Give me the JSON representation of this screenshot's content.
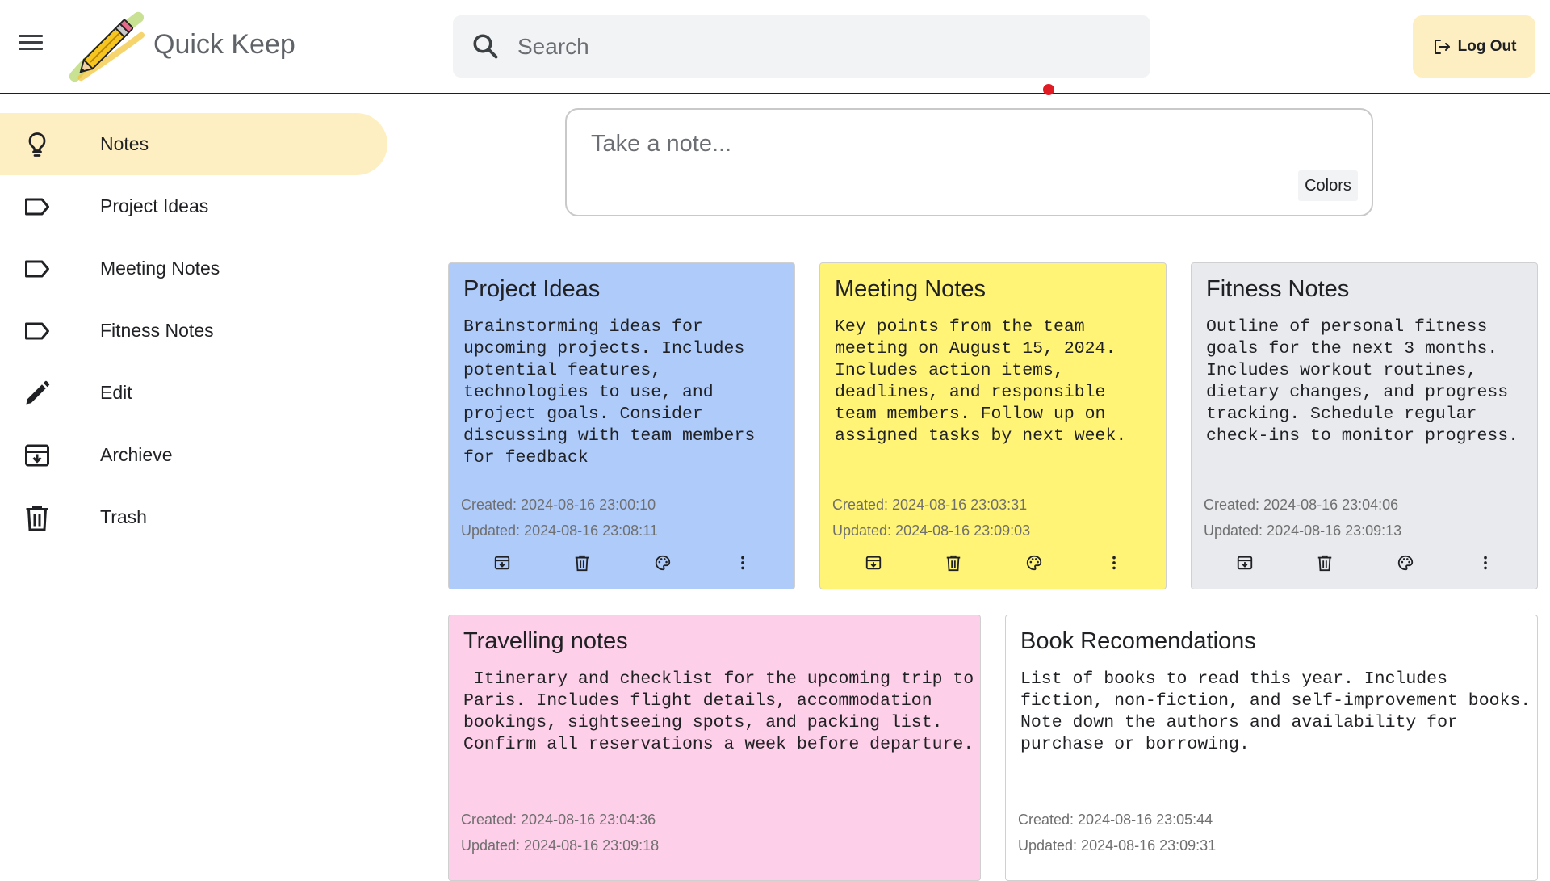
{
  "app": {
    "title": "Quick Keep"
  },
  "header": {
    "search_placeholder": "Search",
    "logout_label": "Log Out"
  },
  "sidebar": {
    "items": [
      {
        "label": "Notes",
        "icon": "lightbulb-icon",
        "active": true
      },
      {
        "label": "Project Ideas",
        "icon": "label-icon"
      },
      {
        "label": "Meeting Notes",
        "icon": "label-icon"
      },
      {
        "label": "Fitness Notes",
        "icon": "label-icon"
      },
      {
        "label": "Edit",
        "icon": "pencil-icon"
      },
      {
        "label": "Archieve",
        "icon": "archive-icon"
      },
      {
        "label": "Trash",
        "icon": "trash-icon"
      }
    ]
  },
  "composer": {
    "placeholder": "Take a note...",
    "colors_label": "Colors"
  },
  "notes": [
    {
      "title": "Project Ideas",
      "body": "Brainstorming ideas for\nupcoming projects. Includes\npotential features,\ntechnologies to use, and\nproject goals. Consider\ndiscussing with team members\nfor feedback",
      "created": "Created: 2024-08-16 23:00:10",
      "updated": "Updated: 2024-08-16 23:08:11",
      "color": "#aecbfa"
    },
    {
      "title": "Meeting Notes",
      "body": "Key points from the team\nmeeting on August 15, 2024.\nIncludes action items,\ndeadlines, and responsible\nteam members. Follow up on\nassigned tasks by next week.",
      "created": "Created: 2024-08-16 23:03:31",
      "updated": "Updated: 2024-08-16 23:09:03",
      "color": "#fff475"
    },
    {
      "title": "Fitness Notes",
      "body": "Outline of personal fitness\ngoals for the next 3 months.\nIncludes workout routines,\ndietary changes, and progress\ntracking. Schedule regular\ncheck-ins to monitor progress.",
      "created": "Created: 2024-08-16 23:04:06",
      "updated": "Updated: 2024-08-16 23:09:13",
      "color": "#e8eaed"
    },
    {
      "title": "Travelling notes",
      "body": " Itinerary and checklist for the upcoming trip to\nParis. Includes flight details, accommodation\nbookings, sightseeing spots, and packing list.\nConfirm all reservations a week before departure.",
      "created": "Created: 2024-08-16 23:04:36",
      "updated": "Updated: 2024-08-16 23:09:18",
      "color": "#fdcfe8"
    },
    {
      "title": "Book Recomendations",
      "body": "List of books to read this year. Includes\nfiction, non-fiction, and self-improvement books.\nNote down the authors and availability for\npurchase or borrowing.",
      "created": "Created: 2024-08-16 23:05:44",
      "updated": "Updated: 2024-08-16 23:09:31",
      "color": "#ffffff"
    }
  ]
}
